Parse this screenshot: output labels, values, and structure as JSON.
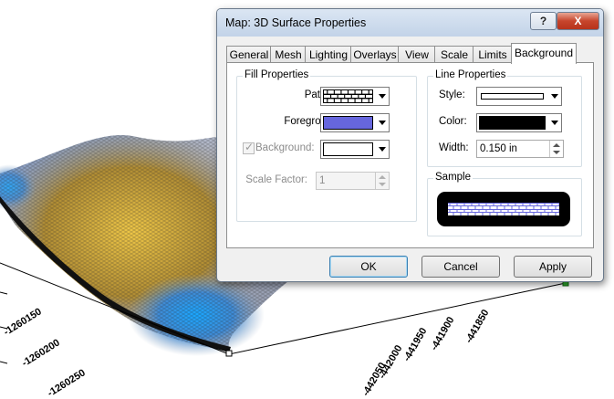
{
  "scene": {
    "axis_labels": [
      "-1260150",
      "-1260200",
      "-1260250",
      "-441950",
      "-442000",
      "-442050",
      "-441900",
      "-441850"
    ]
  },
  "dialog": {
    "title": "Map: 3D Surface Properties",
    "help_label": "?",
    "close_label": "X",
    "tabs": [
      "General",
      "Mesh",
      "Lighting",
      "Overlays",
      "View",
      "Scale",
      "Limits",
      "Background"
    ],
    "active_tab": "Background",
    "fill": {
      "title": "Fill Properties",
      "pattern_label": "Pattern:",
      "foreground_label": "Foreground:",
      "foreground_color": "#6666dd",
      "background_label": "Background:",
      "background_color": "#ffffff",
      "scale_label": "Scale Factor:",
      "scale_value": "1"
    },
    "line": {
      "title": "Line Properties",
      "style_label": "Style:",
      "color_label": "Color:",
      "color_value": "#000000",
      "width_label": "Width:",
      "width_value": "0.150 in"
    },
    "sample": {
      "title": "Sample"
    },
    "buttons": {
      "ok": "OK",
      "cancel": "Cancel",
      "apply": "Apply"
    }
  },
  "colors": {
    "accent": "#3c7fb1",
    "surface_blue": "#2f9be8",
    "surface_gold": "#c89a1e"
  }
}
